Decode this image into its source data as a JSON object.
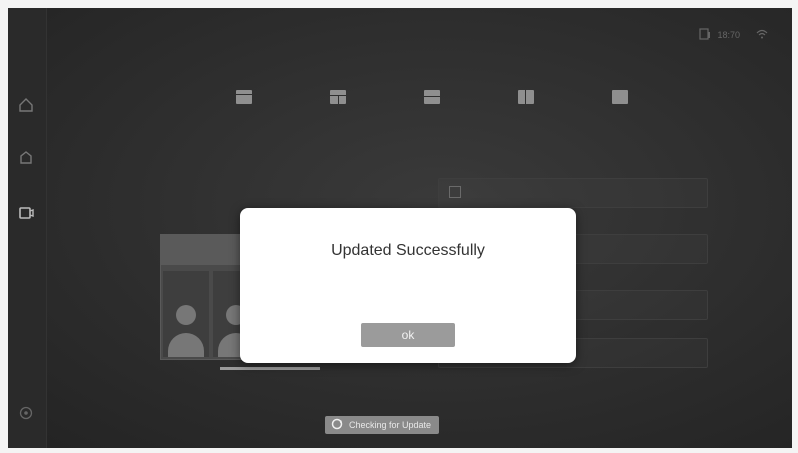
{
  "sidebar": {
    "items": [
      {
        "icon": "home-icon"
      },
      {
        "icon": "apps-icon"
      },
      {
        "icon": "screen-share-icon"
      },
      {
        "icon": "settings-icon"
      }
    ]
  },
  "status_bar": {
    "text": "18:70",
    "icons": [
      "device-icon",
      "wifi-icon"
    ]
  },
  "layout_options": [
    "layout-1-icon",
    "layout-2-icon",
    "layout-3-icon",
    "layout-4-icon",
    "layout-5-icon"
  ],
  "dialog": {
    "title": "Updated Successfully",
    "ok_label": "ok"
  },
  "update_button": {
    "label": "Checking for Update",
    "icon": "refresh-icon"
  },
  "colors": {
    "background": "#2c2c2c",
    "dialog_bg": "#ffffff",
    "button_bg": "#9b9b9b"
  }
}
